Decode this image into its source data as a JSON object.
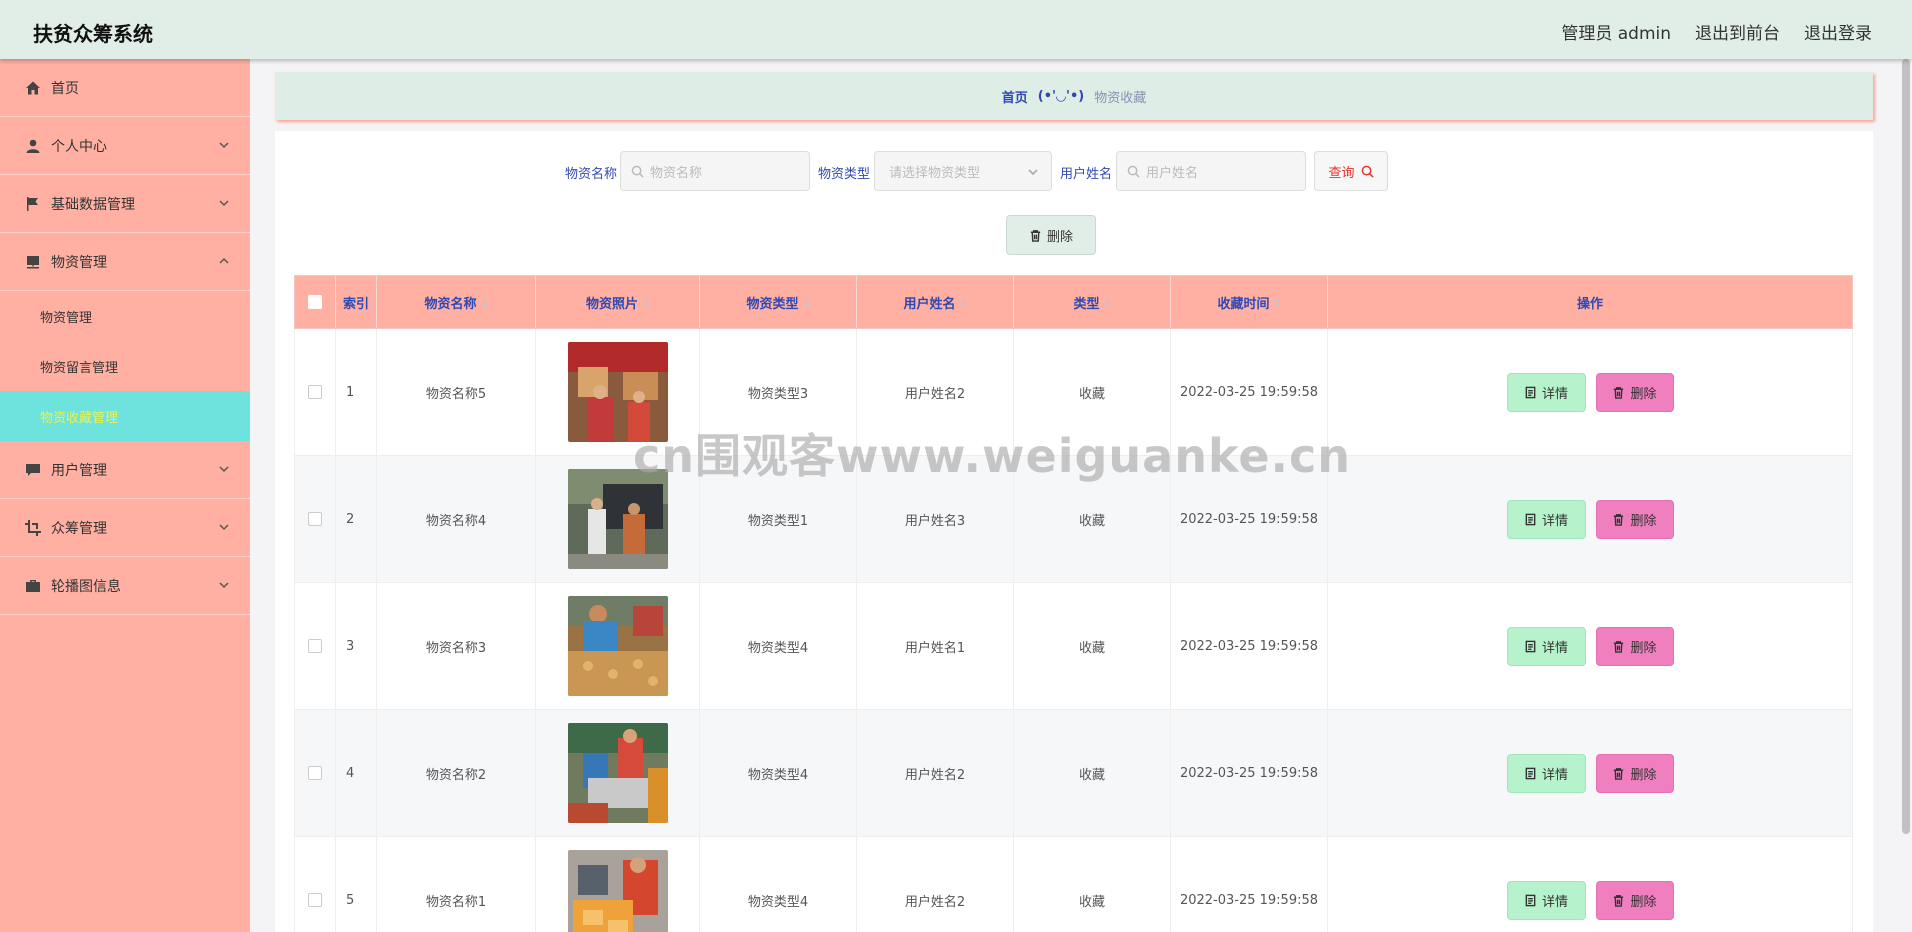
{
  "header": {
    "title": "扶贫众筹系统",
    "admin": "管理员 admin",
    "to_front": "退出到前台",
    "logout": "退出登录"
  },
  "sidebar": {
    "items": [
      {
        "label": "首页",
        "icon": "home-icon"
      },
      {
        "label": "个人中心",
        "icon": "user-icon"
      },
      {
        "label": "基础数据管理",
        "icon": "flag-icon"
      },
      {
        "label": "物资管理",
        "icon": "box-icon"
      },
      {
        "label": "用户管理",
        "icon": "chat-icon"
      },
      {
        "label": "众筹管理",
        "icon": "crop-icon"
      },
      {
        "label": "轮播图信息",
        "icon": "briefcase-icon"
      }
    ],
    "sub_items": [
      "物资管理",
      "物资留言管理",
      "物资收藏管理"
    ]
  },
  "breadcrumb": {
    "home": "首页",
    "sep": "(•'◡'•)",
    "current": "物资收藏"
  },
  "search": {
    "name_label": "物资名称",
    "name_placeholder": "物资名称",
    "type_label": "物资类型",
    "type_placeholder": "请选择物资类型",
    "user_label": "用户姓名",
    "user_placeholder": "用户姓名",
    "query_label": "查询",
    "delete_label": "删除"
  },
  "table": {
    "headers": [
      "索引",
      "物资名称",
      "物资照片",
      "物资类型",
      "用户姓名",
      "类型",
      "收藏时间",
      "操作"
    ],
    "detail_label": "详情",
    "delete_label": "删除",
    "rows": [
      {
        "index": "1",
        "name": "物资名称5",
        "type": "物资类型3",
        "user": "用户姓名2",
        "kind": "收藏",
        "time": "2022-03-25 19:59:58"
      },
      {
        "index": "2",
        "name": "物资名称4",
        "type": "物资类型1",
        "user": "用户姓名3",
        "kind": "收藏",
        "time": "2022-03-25 19:59:58"
      },
      {
        "index": "3",
        "name": "物资名称3",
        "type": "物资类型4",
        "user": "用户姓名1",
        "kind": "收藏",
        "time": "2022-03-25 19:59:58"
      },
      {
        "index": "4",
        "name": "物资名称2",
        "type": "物资类型4",
        "user": "用户姓名2",
        "kind": "收藏",
        "time": "2022-03-25 19:59:58"
      },
      {
        "index": "5",
        "name": "物资名称1",
        "type": "物资类型4",
        "user": "用户姓名2",
        "kind": "收藏",
        "time": "2022-03-25 19:59:58"
      }
    ]
  },
  "watermark": "cn围观客www.weiguanke.cn",
  "colors": {
    "topbar": "#e1eee8",
    "sidebar": "#ffb0a2",
    "active_menu": "#6ee3dd",
    "link_blue": "#2f49b3",
    "detail_btn": "#b6f2cb",
    "delete_btn": "#f07fc0"
  }
}
